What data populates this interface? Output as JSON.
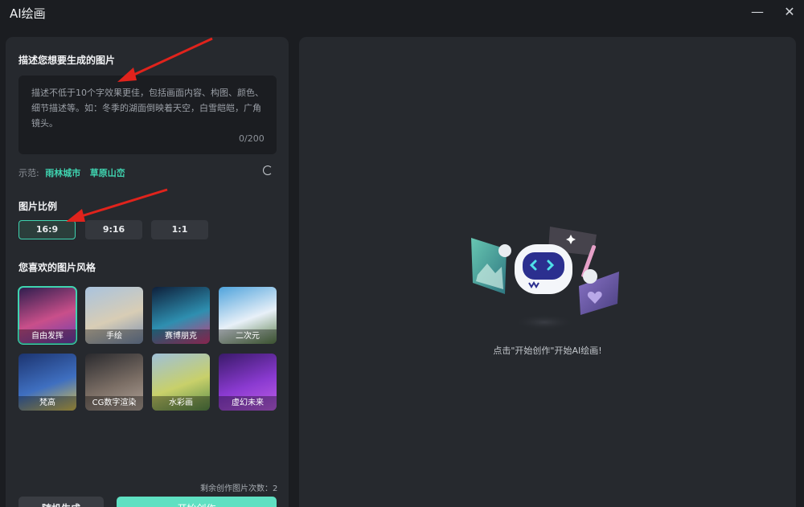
{
  "window": {
    "title": "AI绘画",
    "minimize_glyph": "—",
    "close_glyph": "✕"
  },
  "prompt": {
    "section_title": "描述您想要生成的图片",
    "placeholder": "描述不低于10个字效果更佳，包括画面内容、构图、颜色、细节描述等。如：冬季的湖面倒映着天空，白雪皑皑，广角镜头。",
    "value": "",
    "counter": "0/200"
  },
  "examples": {
    "label": "示范:",
    "items": [
      "雨林城市",
      "草原山峦"
    ],
    "refresh_icon": "refresh-icon"
  },
  "ratio": {
    "section_title": "图片比例",
    "options": [
      "16:9",
      "9:16",
      "1:1"
    ],
    "selected": "16:9"
  },
  "styles": {
    "section_title": "您喜欢的图片风格",
    "items": [
      {
        "label": "自由发挥",
        "colors": [
          "#2b1d4d",
          "#c94f8a",
          "#6a3fb0"
        ]
      },
      {
        "label": "手绘",
        "colors": [
          "#a9c3de",
          "#d8cdb5",
          "#7a8fb0"
        ]
      },
      {
        "label": "赛博朋克",
        "colors": [
          "#0e1f3a",
          "#2e8fb0",
          "#d03a7a"
        ]
      },
      {
        "label": "二次元",
        "colors": [
          "#4fa3dc",
          "#e8f0f8",
          "#5b7f4a"
        ]
      },
      {
        "label": "梵高",
        "colors": [
          "#1c3470",
          "#3f6fc0",
          "#d8c050"
        ]
      },
      {
        "label": "CG数字渲染",
        "colors": [
          "#2a2a2e",
          "#7a6d64",
          "#b0a298"
        ]
      },
      {
        "label": "水彩画",
        "colors": [
          "#9fc0d8",
          "#c8d06a",
          "#5a8c4a"
        ]
      },
      {
        "label": "虚幻未来",
        "colors": [
          "#3a1a6a",
          "#8a3ad0",
          "#c060e8"
        ]
      }
    ],
    "selected": "自由发挥"
  },
  "footer": {
    "remaining_text": "剩余创作图片次数：2",
    "random_button": "随机生成",
    "start_button": "开始创作"
  },
  "preview": {
    "hint": "点击\"开始创作\"开始AI绘画!",
    "colors": {
      "accent": "#3fd4b0",
      "robot_face": "#2b2f8f",
      "robot_eye": "#4fe0e8",
      "card_purple": "#6a5aa0",
      "card_teal": "#4fb0a0"
    }
  }
}
